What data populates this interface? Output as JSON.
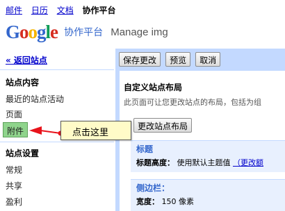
{
  "topnav": {
    "links": [
      "邮件",
      "日历",
      "文档"
    ],
    "current": "协作平台"
  },
  "header": {
    "logo": "Google",
    "product": "协作平台",
    "site_name": "Manage img"
  },
  "sidebar": {
    "back_link": "« 返回站点",
    "site_content": {
      "title": "站点内容",
      "items": [
        "最近的站点活动",
        "页面",
        "附件"
      ]
    },
    "site_settings": {
      "title": "站点设置",
      "items": [
        "常规",
        "共享",
        "盈利"
      ]
    }
  },
  "callout": {
    "text": "点击这里"
  },
  "toolbar": {
    "save": "保存更改",
    "preview": "预览",
    "cancel": "取消"
  },
  "main": {
    "title": "自定义站点布局",
    "description": "此页面可让您更改站点的布局，包括为组",
    "change_layout_button": "更改站点布局",
    "header_box": {
      "label": "标题",
      "height_label": "标题高度：",
      "height_value": "使用默认主题值",
      "change_link": "（更改额"
    },
    "sidebar_box": {
      "label": "侧边栏：",
      "width_label": "宽度：",
      "width_value": "150 像素"
    }
  },
  "colors": {
    "link": "#0000cc",
    "panel_bg": "#c3d9ff",
    "active_item": "#8fd48c",
    "callout_bg": "#fffbc8",
    "arrow": "#e8131b"
  }
}
